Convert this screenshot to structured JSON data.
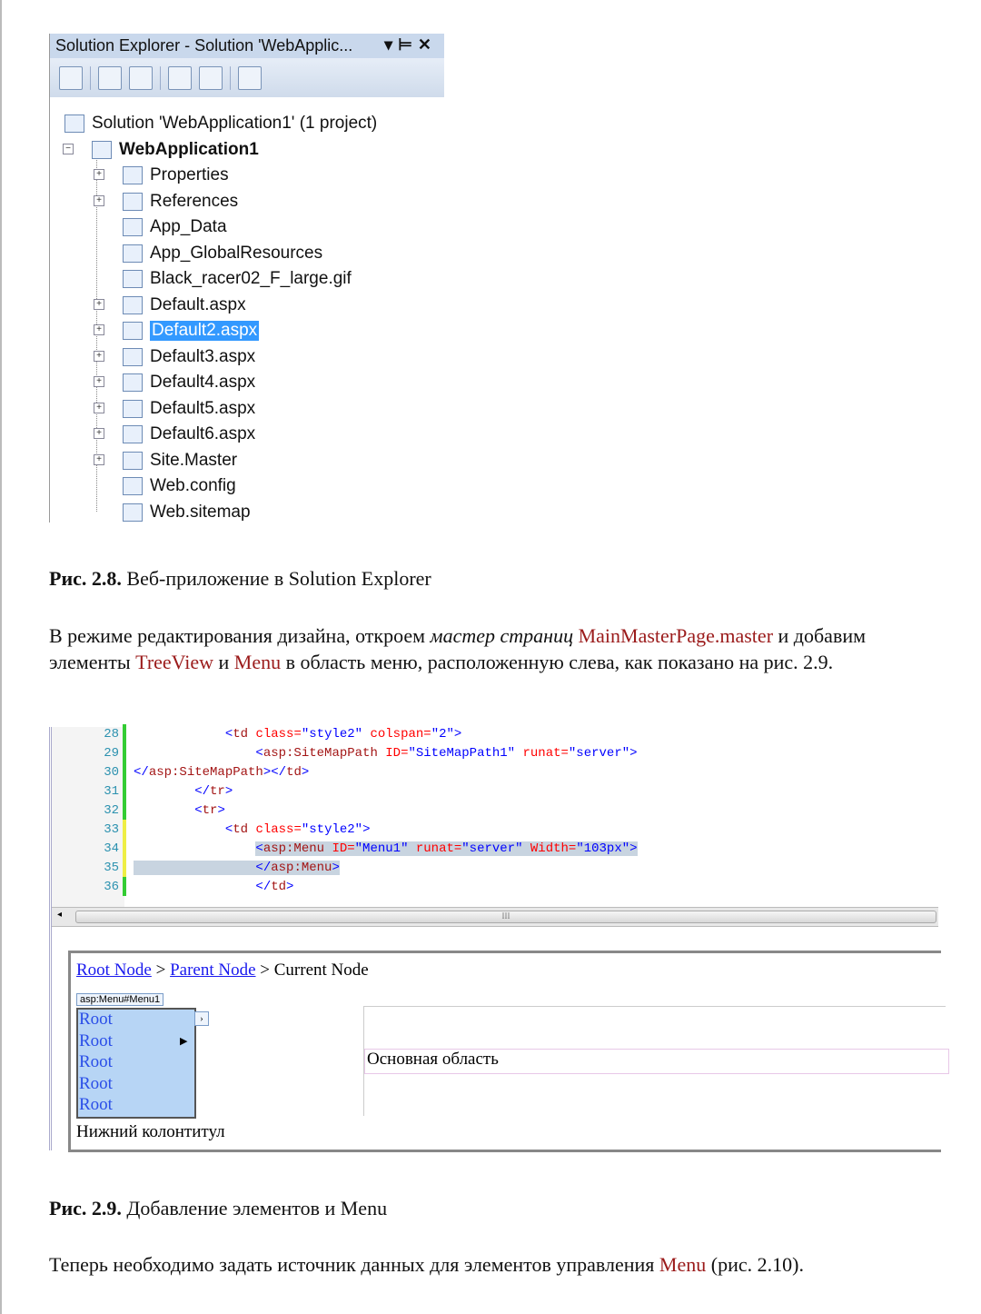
{
  "solution_explorer": {
    "title": "Solution Explorer - Solution 'WebApplic...",
    "controls": [
      "▾",
      "⊨",
      "✕"
    ],
    "toolbar_icons": [
      "properties-icon",
      "show-all-files-icon",
      "refresh-icon",
      "view-code-icon",
      "view-designer-icon",
      "copy-website-icon"
    ],
    "items": [
      {
        "label": "Solution 'WebApplication1' (1 project)",
        "level": 0,
        "expander": "",
        "icon": "solution-icon"
      },
      {
        "label": "WebApplication1",
        "level": 1,
        "expander": "−",
        "icon": "web-project-icon",
        "bold": true
      },
      {
        "label": "Properties",
        "level": 2,
        "expander": "+",
        "icon": "properties-folder-icon"
      },
      {
        "label": "References",
        "level": 2,
        "expander": "+",
        "icon": "references-folder-icon"
      },
      {
        "label": "App_Data",
        "level": 2,
        "expander": "",
        "icon": "folder-icon"
      },
      {
        "label": "App_GlobalResources",
        "level": 2,
        "expander": "",
        "icon": "resources-folder-icon"
      },
      {
        "label": "Black_racer02_F_large.gif",
        "level": 2,
        "expander": "",
        "icon": "image-file-icon"
      },
      {
        "label": "Default.aspx",
        "level": 2,
        "expander": "+",
        "icon": "aspx-file-icon"
      },
      {
        "label": "Default2.aspx",
        "level": 2,
        "expander": "+",
        "icon": "aspx-file-icon",
        "selected": true
      },
      {
        "label": "Default3.aspx",
        "level": 2,
        "expander": "+",
        "icon": "aspx-file-icon"
      },
      {
        "label": "Default4.aspx",
        "level": 2,
        "expander": "+",
        "icon": "aspx-file-icon"
      },
      {
        "label": "Default5.aspx",
        "level": 2,
        "expander": "+",
        "icon": "aspx-file-icon"
      },
      {
        "label": "Default6.aspx",
        "level": 2,
        "expander": "+",
        "icon": "aspx-file-icon"
      },
      {
        "label": "Site.Master",
        "level": 2,
        "expander": "+",
        "icon": "master-file-icon"
      },
      {
        "label": "Web.config",
        "level": 2,
        "expander": "",
        "icon": "config-file-icon"
      },
      {
        "label": "Web.sitemap",
        "level": 2,
        "expander": "",
        "icon": "sitemap-file-icon"
      }
    ]
  },
  "caption1": {
    "num": "Рис. 2.8.",
    "text": " Веб-приложение в Solution Explorer"
  },
  "para1": {
    "a": "В режиме редактирования дизайна, откроем ",
    "b": "мастер страниц",
    "c": " ",
    "d": "MainMasterPage.master",
    "e": " и добавим элементы ",
    "f": "TreeView",
    "g": " и ",
    "h": "Menu",
    "i": " в область меню, расположенную слева, как показано на рис. 2.9."
  },
  "code": {
    "lines": [
      {
        "n": "28",
        "mark": "g",
        "tokens": [
          [
            "",
            "            "
          ],
          [
            "b",
            "<"
          ],
          [
            "t",
            "td"
          ],
          [
            "a",
            " class="
          ],
          [
            "v",
            "\"style2\""
          ],
          [
            "a",
            " colspan="
          ],
          [
            "v",
            "\"2\""
          ],
          [
            "b",
            ">"
          ]
        ]
      },
      {
        "n": "29",
        "mark": "g",
        "tokens": [
          [
            "",
            "                "
          ],
          [
            "b",
            "<"
          ],
          [
            "t",
            "asp:SiteMapPath"
          ],
          [
            "a",
            " ID="
          ],
          [
            "v",
            "\"SiteMapPath1\""
          ],
          [
            "a",
            " runat="
          ],
          [
            "v",
            "\"server\""
          ],
          [
            "b",
            ">"
          ]
        ]
      },
      {
        "n": "30",
        "mark": "g",
        "tokens": [
          [
            "b",
            "</"
          ],
          [
            "t",
            "asp:SiteMapPath"
          ],
          [
            "b",
            "></"
          ],
          [
            "t",
            "td"
          ],
          [
            "b",
            ">"
          ]
        ]
      },
      {
        "n": "31",
        "mark": "g",
        "tokens": [
          [
            "",
            "        "
          ],
          [
            "b",
            "</"
          ],
          [
            "t",
            "tr"
          ],
          [
            "b",
            ">"
          ]
        ]
      },
      {
        "n": "32",
        "mark": "g",
        "tokens": [
          [
            "",
            "        "
          ],
          [
            "b",
            "<"
          ],
          [
            "t",
            "tr"
          ],
          [
            "b",
            ">"
          ]
        ]
      },
      {
        "n": "33",
        "mark": "y",
        "tokens": [
          [
            "",
            "            "
          ],
          [
            "b",
            "<"
          ],
          [
            "t",
            "td"
          ],
          [
            "a",
            " class="
          ],
          [
            "v",
            "\"style2\""
          ],
          [
            "b",
            ">"
          ]
        ]
      },
      {
        "n": "34",
        "mark": "y",
        "hl": "from16",
        "tokens": [
          [
            "",
            "                "
          ],
          [
            "b",
            "<"
          ],
          [
            "t",
            "asp:Menu"
          ],
          [
            "a",
            " ID="
          ],
          [
            "v",
            "\"Menu1\""
          ],
          [
            "a",
            " runat="
          ],
          [
            "v",
            "\"server\""
          ],
          [
            "a",
            " Width="
          ],
          [
            "v",
            "\"103px\""
          ],
          [
            "b",
            ">"
          ]
        ]
      },
      {
        "n": "35",
        "mark": "y",
        "hl": "all",
        "tokens": [
          [
            "",
            "                "
          ],
          [
            "b",
            "</"
          ],
          [
            "t",
            "asp:Menu"
          ],
          [
            "b",
            ">"
          ]
        ]
      },
      {
        "n": "36",
        "mark": "g",
        "tokens": [
          [
            "",
            "                "
          ],
          [
            "b",
            "</"
          ],
          [
            "t",
            "td"
          ],
          [
            "b",
            ">"
          ]
        ]
      }
    ],
    "scroll_grip": "III"
  },
  "design": {
    "breadcrumb": [
      "Root Node",
      "Parent Node",
      "Current Node"
    ],
    "separator": " > ",
    "menu_tag": "asp:Menu#Menu1",
    "menu_items": [
      "Root",
      "Root",
      "Root",
      "Root",
      "Root"
    ],
    "main_label": "Основная область",
    "footer_label": "Нижний колонтитул"
  },
  "caption2": {
    "num": "Рис. 2.9.",
    "text": " Добавление элементов и Menu"
  },
  "para2": {
    "a": "Теперь необходимо задать источник данных для элементов управления ",
    "b": "Menu",
    "c": " (рис. 2.10)."
  }
}
